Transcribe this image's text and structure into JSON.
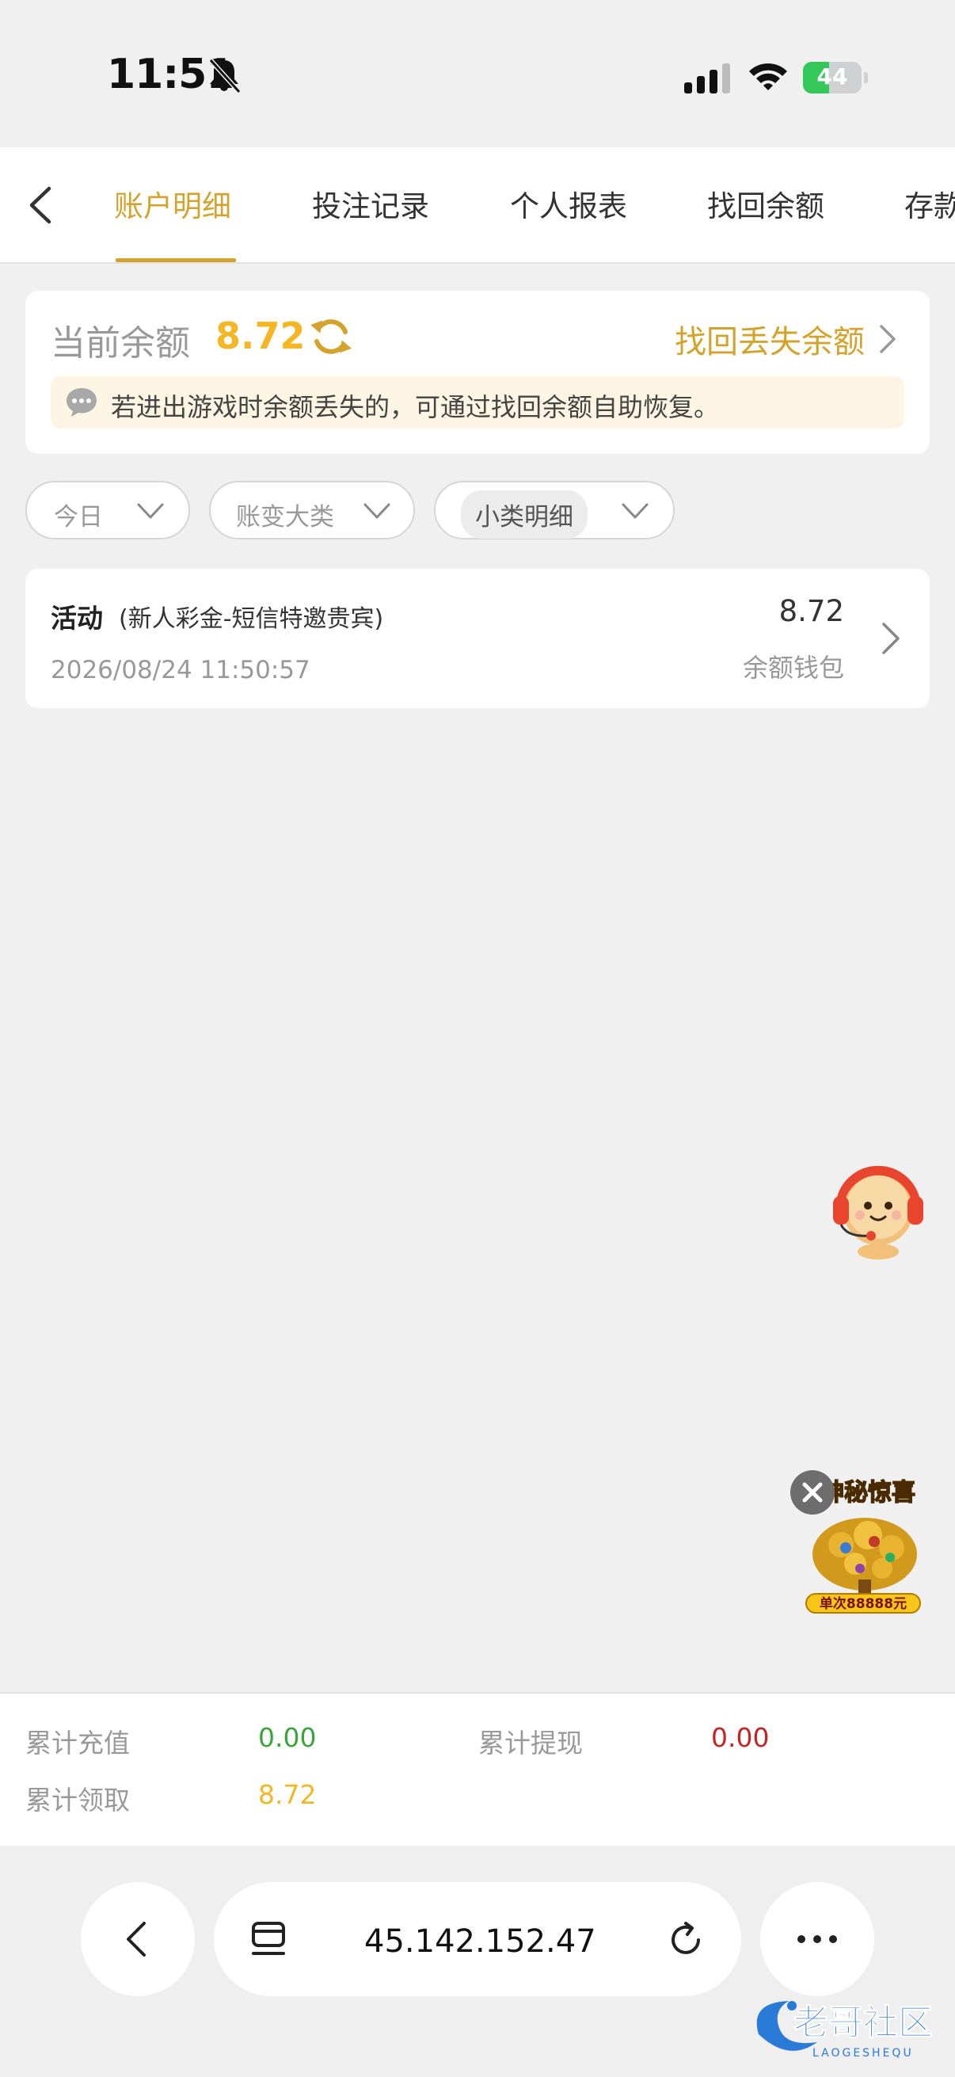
{
  "status_bar": {
    "time": "11:51",
    "battery": "44",
    "battery_level": 0.44
  },
  "tabs": [
    {
      "label": "账户明细",
      "active": true
    },
    {
      "label": "投注记录",
      "active": false
    },
    {
      "label": "个人报表",
      "active": false
    },
    {
      "label": "找回余额",
      "active": false
    },
    {
      "label": "存款",
      "active": false
    }
  ],
  "balance": {
    "label": "当前余额",
    "value": "8.72",
    "recover_link": "找回丢失余额",
    "notice": "若进出游戏时余额丢失的，可通过找回余额自助恢复。"
  },
  "filters": [
    {
      "label": "今日"
    },
    {
      "label": "账变大类"
    },
    {
      "label": "小类明细"
    }
  ],
  "records": [
    {
      "category": "活动",
      "description": "(新人彩金-短信特邀贵宾)",
      "time": "2026/08/24 11:50:57",
      "amount": "8.72",
      "wallet": "余额钱包"
    }
  ],
  "promo": {
    "title": "神秘惊喜",
    "subtitle": "单次88888元"
  },
  "summary": {
    "recharge_label": "累计充值",
    "recharge_value": "0.00",
    "withdraw_label": "累计提现",
    "withdraw_value": "0.00",
    "claimed_label": "累计领取",
    "claimed_value": "8.72"
  },
  "browser": {
    "url": "45.142.152.47"
  },
  "watermark": {
    "text": "老哥社区",
    "sub": "LAOGESHEQU"
  },
  "colors": {
    "accent": "#d4a32b",
    "balance": "#f5b623",
    "green": "#3aa53a",
    "red": "#c82323"
  }
}
